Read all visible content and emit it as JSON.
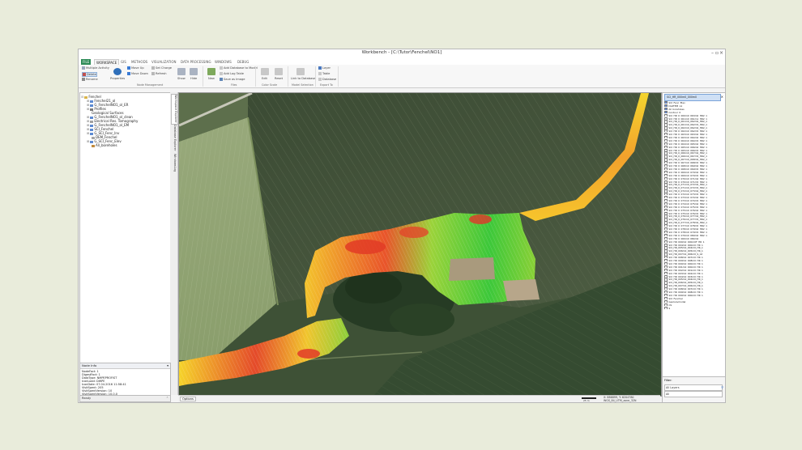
{
  "window": {
    "title": "Workbench - [C:\\Tutor\\Fenchel\\NO1]",
    "controls": [
      "–",
      "▫",
      "×"
    ]
  },
  "tabs": [
    "FILE",
    "WORKSPACE",
    "GIS",
    "METHODS",
    "VISUALIZATION",
    "DATA PROCESSING",
    "WINDOWS",
    "DEBUG"
  ],
  "ribbon": {
    "nodeleft": [
      "Multiple Activity",
      "Delete",
      "Rename"
    ],
    "properties": "Properties",
    "move": [
      "Move Up",
      "Move Down"
    ],
    "nodemid": [
      "Set Charge",
      "Refresh"
    ],
    "views": [
      "Show",
      "Hide"
    ],
    "filesbig": "New",
    "files": [
      "Add Database to Model",
      "Add Log Table",
      "Save as Image"
    ],
    "colorscale": [
      "Edit",
      "Reset"
    ],
    "modelsel": "Link to Database",
    "exportitems": [
      "Layer",
      "Table",
      "Database"
    ],
    "groups": [
      "Node Management",
      "Files",
      "Color Scale",
      "Model Selection",
      "Export To"
    ]
  },
  "tree": [
    {
      "label": "Fenchel",
      "icon": "project",
      "expander": "⊟"
    },
    {
      "label": "Fenchel21_ol",
      "icon": "layer",
      "expander": "⊞"
    },
    {
      "label": "G_FenchelNO1_ol_ER",
      "icon": "layer",
      "expander": "⊞"
    },
    {
      "label": "Profiles",
      "icon": "layer",
      "expander": "⊞"
    },
    {
      "label": "Geological Surfaces",
      "icon": "none",
      "expander": ""
    },
    {
      "label": "G_FenchelNO1_ol_clean",
      "icon": "layer",
      "expander": "⊞"
    },
    {
      "label": "Electrical Res. Tomography",
      "icon": "layer",
      "expander": "⊞"
    },
    {
      "label": "G_FenchelNO1_ol_EM",
      "icon": "layer",
      "expander": "⊞"
    },
    {
      "label": "SCI_Fenchel",
      "icon": "layer",
      "expander": "⊞"
    },
    {
      "label": "G_SCI_Fenc_Inv",
      "icon": "layer",
      "expander": "⊞"
    },
    {
      "label": "DEM_Fenchel",
      "icon": "layer",
      "expander": ""
    },
    {
      "label": "G_SCI_Fenc_Elev",
      "icon": "layer",
      "expander": "⊞"
    },
    {
      "label": "All_boreholes",
      "icon": "layer",
      "expander": ""
    }
  ],
  "sidetabs": [
    "Workspace Explorer",
    "Database Explorer",
    "Windows",
    "Log"
  ],
  "info": {
    "header": "Node Info",
    "lines": [
      "NodeFact: 1",
      "DigestFact: 1",
      "DataType: NMPEPROFIST",
      "IconLoad: DWPE",
      "IconDate: 07.04.2016 11:58:41",
      "VisitSpent: 205",
      "VisitSpentVersion: 10",
      "VisitSpentVersion: 10.0.0"
    ]
  },
  "status": "Ready",
  "map": {
    "status_left": "Options",
    "coords": "X: 886899, Y: 6204780",
    "projection": "WGS_84_UTM_zone_32N",
    "scale_label": "25 m"
  },
  "right": {
    "title": "SCI_HR_000m0_000m0",
    "items": [
      "SCI_Fenc_Elev",
      "DistTEM_p1",
      "All_boreholes",
      "Contour_0",
      "SCI_HR_0_000m0_063m0_HR2_1",
      "SCI_HR_0_061m0_061m1_HR2_1",
      "SCI_HR_0_061m0_062m0_HR2_1",
      "SCI_HR_0_061m0_062m5_HR2_1",
      "SCI_HR_0_062m0_062m0_HR2_1",
      "SCI_HR_0_062m0_062m5_HR2_1",
      "SCI_HR_0_063m0_063m0_HR2_1",
      "SCI_HR_0_063m0_064m0_HR2_1",
      "SCI_HR_0_064m0_064m5_HR2_1",
      "SCI_HR_0_064m0_065m0_HR2_1",
      "SCI_HR_0_065m0_066m0_HR2_1",
      "SCI_HR_0_065m0_066m5_HR2_1",
      "SCI_HR_0_066m0_067m0_HR2_1",
      "SCI_HR_0_066m0_067m5_HR2_1",
      "SCI_HR_0_067m0_068m0_HR2_1",
      "SCI_HR_0_067m0_068m5_HR2_1",
      "SCI_HR_0_068m0_069m0_HR2_1",
      "SCI_HR_0_068m0_069m5_HR2_1",
      "SCI_HR_0_069m0_070m0_HR2_1",
      "SCI_HR_0_069m0_070m5_HR2_1",
      "SCI_HR_0_070m0_071m0_HR2_1",
      "SCI_HR_0_070m0_071m5_HR2_1",
      "SCI_HR_0_071m0_072m0_HR2_1",
      "SCI_HR_0_071m0_072m5_HR2_1",
      "SCI_HR_0_072m0_073m0_HR2_1",
      "SCI_HR_0_072m0_073m5_HR2_1",
      "SCI_HR_0_073m0_074m0_HR2_1",
      "SCI_HR_0_073m0_074m5_HR2_1",
      "SCI_HR_0_074m0_075m0_HR2_1",
      "SCI_HR_0_074m0_075m5_HR2_1",
      "SCI_HR_0_075m0_076m0_HR2_1",
      "SCI_HR_0_075m0_076m5_HR2_1",
      "SCI_HR_0_076m0_077m0_HR2_1",
      "SCI_HR_0_076m0_077m5_HR2_1",
      "SCI_HR_0_077m0_078m0_HR2_1",
      "SCI_HR_0_077m0_078m5_HR2_1",
      "SCI_HR_0_078m0_079m0_HR2_1",
      "SCI_HR_0_078m0_079m5_HR2_1",
      "SCI_HR_0_079m0_080m0_HR2_1",
      "SCI_HR_0_000m0_084m0",
      "SCI_HR_000m0_000m0F_HR_1",
      "SCI_HR_004m0_000m0_HR_1",
      "SCI_HR_005m0_004m0_HR_1",
      "SCI_HR_006m0_005m0_HR_1",
      "SCI_HR_007m0_006m0_S_Gt",
      "SCI_HR_008m0_007m0_HR_1",
      "SCI_HR_009m0_008m0_HR_1",
      "SCI_HR_000m0_000m0_HR_1",
      "SCI_HR_001m0_000m0_HR_1",
      "SCI_HR_002m0_001m0_HR_1",
      "SCI_HR_003m0_002m0_HR_1",
      "SCI_HR_004m0_003m0_HR_1",
      "SCI_HR_005m0_004m0_HR_1",
      "SCI_HR_006m0_005m0_HR_1",
      "SCI_HR_007m0_006m0_HR_1",
      "SCI_HR_008m0_007m0_HR_1",
      "SCI_HR_009m0_008m0_HR_1",
      "SCI_HR_000m0_000m0_HR_1",
      "SCI_Fenchel",
      "Geologymodel",
      "CS",
      "S"
    ],
    "filter_label": "Filter:",
    "filter1": "All Layers",
    "filter2": "All"
  },
  "colors": {
    "accent": "#2e8b57",
    "selection": "#cfe0f5"
  }
}
